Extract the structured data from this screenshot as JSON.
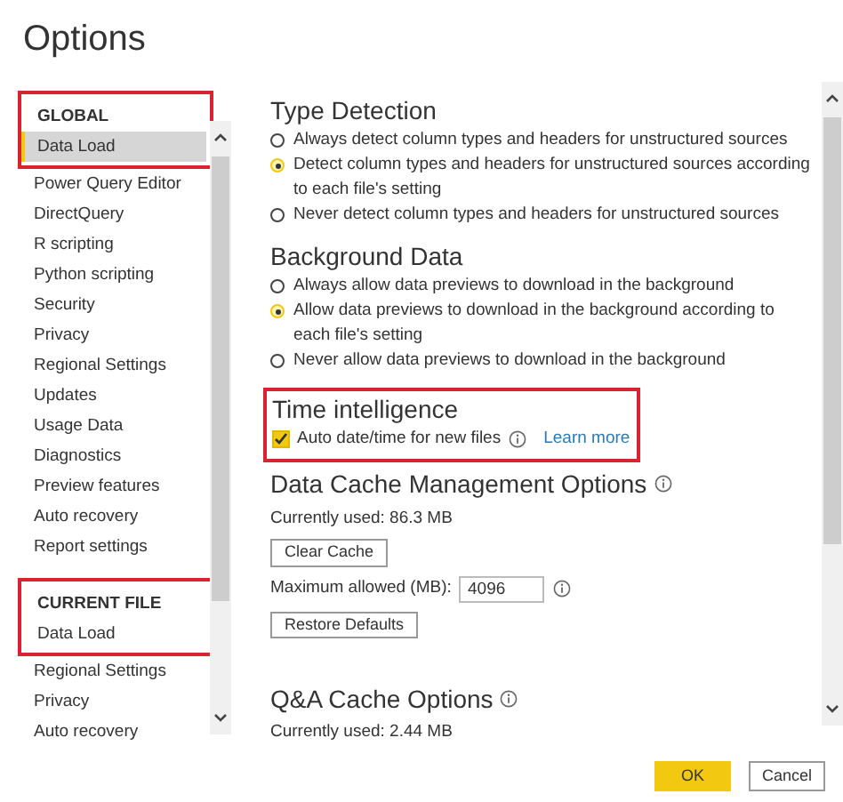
{
  "window": {
    "title": "Options"
  },
  "sidebar": {
    "sections": [
      {
        "heading": "GLOBAL",
        "highlighted": true,
        "items": [
          {
            "label": "Data Load",
            "selected": true
          },
          {
            "label": "Power Query Editor",
            "selected": false
          },
          {
            "label": "DirectQuery",
            "selected": false
          },
          {
            "label": "R scripting",
            "selected": false
          },
          {
            "label": "Python scripting",
            "selected": false
          },
          {
            "label": "Security",
            "selected": false
          },
          {
            "label": "Privacy",
            "selected": false
          },
          {
            "label": "Regional Settings",
            "selected": false
          },
          {
            "label": "Updates",
            "selected": false
          },
          {
            "label": "Usage Data",
            "selected": false
          },
          {
            "label": "Diagnostics",
            "selected": false
          },
          {
            "label": "Preview features",
            "selected": false
          },
          {
            "label": "Auto recovery",
            "selected": false
          },
          {
            "label": "Report settings",
            "selected": false
          }
        ]
      },
      {
        "heading": "CURRENT FILE",
        "highlighted": true,
        "items": [
          {
            "label": "Data Load",
            "selected": false
          },
          {
            "label": "Regional Settings",
            "selected": false
          },
          {
            "label": "Privacy",
            "selected": false
          },
          {
            "label": "Auto recovery",
            "selected": false
          }
        ]
      }
    ]
  },
  "type_detection": {
    "title": "Type Detection",
    "options": [
      {
        "label": "Always detect column types and headers for unstructured sources",
        "selected": false
      },
      {
        "label": "Detect column types and headers for unstructured sources according to each file's setting",
        "selected": true
      },
      {
        "label": "Never detect column types and headers for unstructured sources",
        "selected": false
      }
    ]
  },
  "background_data": {
    "title": "Background Data",
    "options": [
      {
        "label": "Always allow data previews to download in the background",
        "selected": false
      },
      {
        "label": "Allow data previews to download in the background according to each file's setting",
        "selected": true
      },
      {
        "label": "Never allow data previews to download in the background",
        "selected": false
      }
    ]
  },
  "time_intelligence": {
    "title": "Time intelligence",
    "highlighted": true,
    "checkbox": {
      "label": "Auto date/time for new files",
      "checked": true
    },
    "link": "Learn more"
  },
  "data_cache": {
    "title": "Data Cache Management Options",
    "used": "Currently used: 86.3 MB",
    "clear_button": "Clear Cache",
    "max_label": "Maximum allowed (MB):",
    "max_value": "4096",
    "restore_button": "Restore Defaults"
  },
  "qa_cache": {
    "title": "Q&A Cache Options",
    "used": "Currently used: 2.44 MB"
  },
  "buttons": {
    "ok": "OK",
    "cancel": "Cancel"
  }
}
